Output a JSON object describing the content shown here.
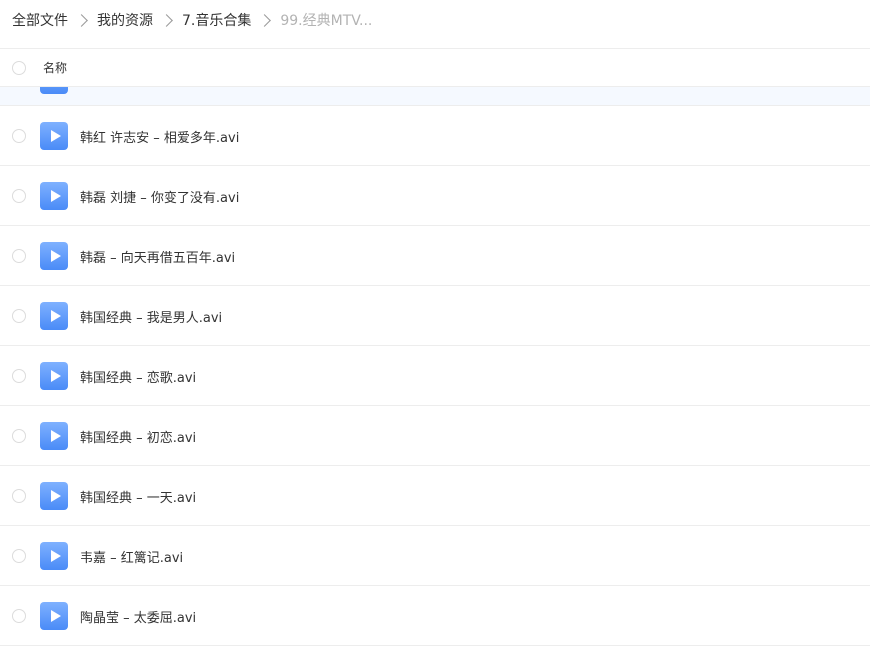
{
  "breadcrumb": {
    "items": [
      "全部文件",
      "我的资源",
      "7.音乐合集"
    ],
    "current": "99.经典MTV..."
  },
  "header": {
    "name_label": "名称"
  },
  "icons": {
    "file": "video-file-icon",
    "separator": "chevron-right-icon",
    "checkbox": "circle-checkbox"
  },
  "colors": {
    "accent": "#4a8bf7",
    "highlight_row": "#f5f9ff",
    "divider": "#ededed",
    "breadcrumb_current": "#b3b3b3"
  },
  "files": [
    {
      "name": "韩红 许志安 – 相爱多年.avi"
    },
    {
      "name": "韩磊 刘捷 – 你变了没有.avi"
    },
    {
      "name": "韩磊 – 向天再借五百年.avi"
    },
    {
      "name": "韩国经典 – 我是男人.avi"
    },
    {
      "name": "韩国经典 – 恋歌.avi"
    },
    {
      "name": "韩国经典 – 初恋.avi"
    },
    {
      "name": "韩国经典 – 一天.avi"
    },
    {
      "name": "韦嘉 – 红篱记.avi"
    },
    {
      "name": "陶晶莹 – 太委屈.avi"
    }
  ]
}
